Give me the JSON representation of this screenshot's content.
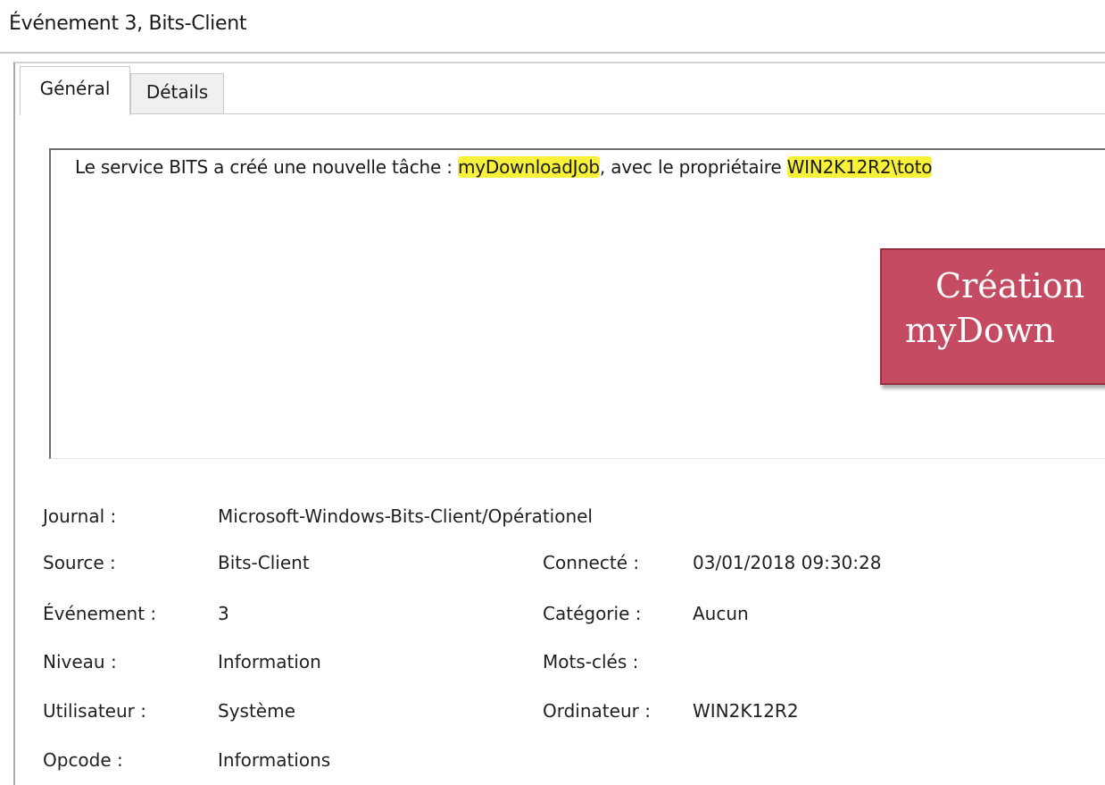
{
  "window": {
    "title": "Événement 3, Bits-Client"
  },
  "tabs": [
    {
      "label": "Général",
      "active": true
    },
    {
      "label": "Détails",
      "active": false
    }
  ],
  "message": {
    "before": "Le service BITS a créé une nouvelle tâche : ",
    "job_name": "myDownloadJob",
    "middle": ", avec le propriétaire ",
    "owner": "WIN2K12R2\\toto",
    "highlight_color": "#f7f13a"
  },
  "callout": {
    "line1": "Création",
    "line2": "myDown",
    "background_color": "#c54b62"
  },
  "properties": {
    "journal": {
      "label": "Journal :",
      "value": "Microsoft-Windows-Bits-Client/Opérationel"
    },
    "source": {
      "label": "Source :",
      "value": "Bits-Client"
    },
    "evenement": {
      "label": "Événement :",
      "value": "3"
    },
    "niveau": {
      "label": "Niveau :",
      "value": "Information"
    },
    "utilisateur": {
      "label": "Utilisateur :",
      "value": "Système"
    },
    "opcode": {
      "label": "Opcode :",
      "value": "Informations"
    },
    "connecte": {
      "label": "Connecté :",
      "value": "03/01/2018 09:30:28"
    },
    "categorie": {
      "label": "Catégorie :",
      "value": "Aucun"
    },
    "mots_cles": {
      "label": "Mots-clés :",
      "value": ""
    },
    "ordinateur": {
      "label": "Ordinateur :",
      "value": "WIN2K12R2"
    }
  }
}
